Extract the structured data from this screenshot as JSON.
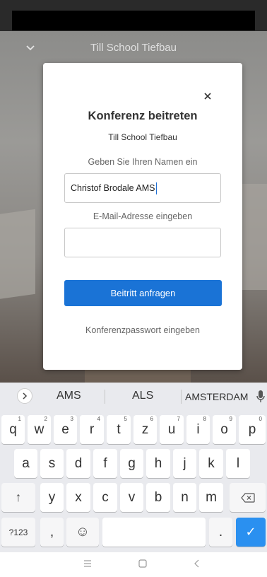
{
  "header": {
    "title": "Till School Tiefbau"
  },
  "dialog": {
    "title": "Konferenz beitreten",
    "subtitle": "Till School Tiefbau",
    "name_label": "Geben Sie Ihren Namen ein",
    "name_value": "Christof Brodale AMS",
    "email_label": "E-Mail-Adresse eingeben",
    "email_value": "",
    "join_button": "Beitritt anfragen",
    "password_link": "Konferenzpasswort eingeben"
  },
  "keyboard": {
    "suggestions": [
      "AMS",
      "ALS",
      "AMSTERDAM"
    ],
    "row1": [
      {
        "k": "q",
        "n": "1"
      },
      {
        "k": "w",
        "n": "2"
      },
      {
        "k": "e",
        "n": "3"
      },
      {
        "k": "r",
        "n": "4"
      },
      {
        "k": "t",
        "n": "5"
      },
      {
        "k": "z",
        "n": "6"
      },
      {
        "k": "u",
        "n": "7"
      },
      {
        "k": "i",
        "n": "8"
      },
      {
        "k": "o",
        "n": "9"
      },
      {
        "k": "p",
        "n": "0"
      }
    ],
    "row2": [
      "a",
      "s",
      "d",
      "f",
      "g",
      "h",
      "j",
      "k",
      "l"
    ],
    "row3": [
      "y",
      "x",
      "c",
      "v",
      "b",
      "n",
      "m"
    ],
    "symbols_key": "?123",
    "comma_key": ",",
    "period_key": ".",
    "emoji_glyph": "☺",
    "shift_glyph": "↑",
    "enter_glyph": "✓"
  },
  "colors": {
    "accent": "#1a73d6",
    "enter": "#2a90f0"
  },
  "icons": [
    "chevron-down-icon",
    "close-icon",
    "chevron-right-icon",
    "mic-icon",
    "backspace-icon",
    "recents-icon",
    "home-icon",
    "back-icon"
  ]
}
